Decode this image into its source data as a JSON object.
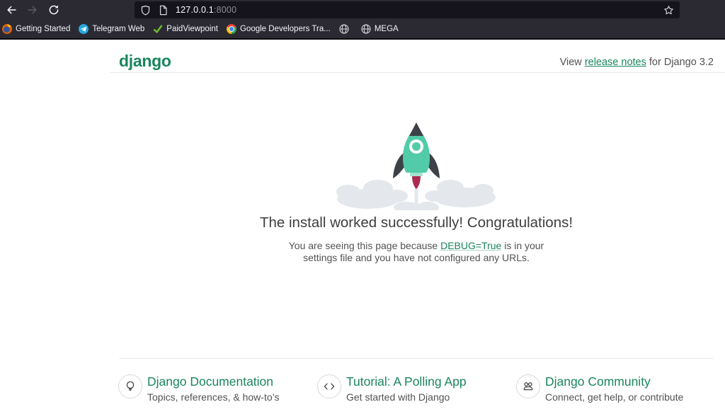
{
  "theme": {
    "green": "#19865C",
    "text": "#525252",
    "heading": "#3E3E3E",
    "toolbar": "#2B2A33",
    "urlbar": "#15141C",
    "mint": "#52CBA8",
    "flame": "#AC2B50",
    "cloud": "#E4E7EB"
  },
  "browser": {
    "url": {
      "host": "127.0.0.1",
      "port": ":8000"
    },
    "bookmarks": [
      {
        "label": "Getting Started",
        "icon": "firefox-icon"
      },
      {
        "label": "Telegram Web",
        "icon": "telegram-icon"
      },
      {
        "label": "PaidViewpoint",
        "icon": "checkmark-icon"
      },
      {
        "label": "Google Developers Tra...",
        "icon": "chrome-icon"
      },
      {
        "label": "",
        "icon": "globe-icon"
      },
      {
        "label": "MEGA",
        "icon": "globe-icon"
      }
    ]
  },
  "page": {
    "logo": "django",
    "release": {
      "prefix": "View ",
      "link": "release notes",
      "suffix": " for Django 3.2"
    },
    "heading": "The install worked successfully! Congratulations!",
    "body": {
      "before": "You are seeing this page because ",
      "link": "DEBUG=True",
      "after": " is in your settings file and you have not configured any URLs."
    },
    "footer": [
      {
        "title": "Django Documentation",
        "subtitle": "Topics, references, & how-to’s",
        "icon": "lightbulb-icon"
      },
      {
        "title": "Tutorial: A Polling App",
        "subtitle": "Get started with Django",
        "icon": "code-icon"
      },
      {
        "title": "Django Community",
        "subtitle": "Connect, get help, or contribute",
        "icon": "people-icon"
      }
    ]
  }
}
